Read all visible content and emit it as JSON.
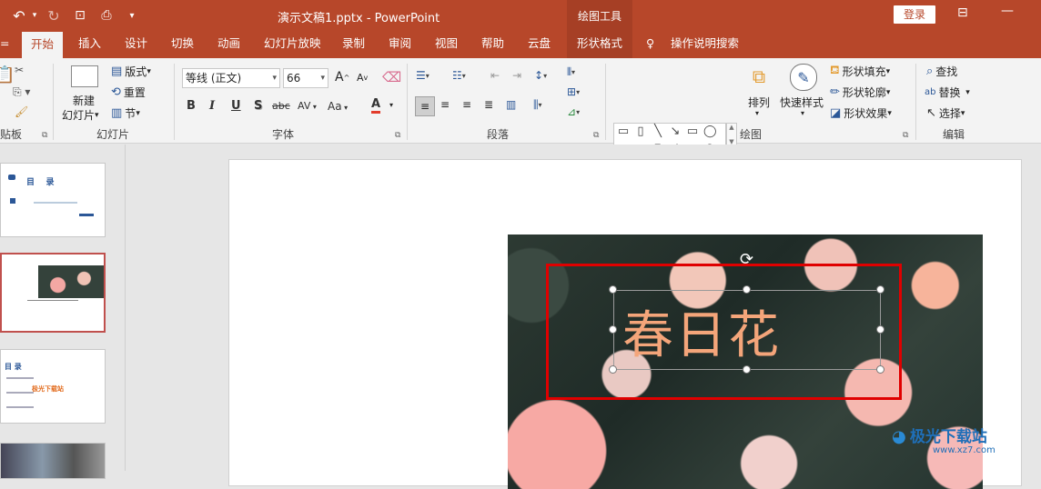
{
  "title_bar": {
    "title": "演示文稿1.pptx  -  PowerPoint",
    "contextual_group": "绘图工具",
    "login": "登录"
  },
  "tabs": [
    {
      "label": "开始"
    },
    {
      "label": "插入"
    },
    {
      "label": "设计"
    },
    {
      "label": "切换"
    },
    {
      "label": "动画"
    },
    {
      "label": "幻灯片放映"
    },
    {
      "label": "录制"
    },
    {
      "label": "审阅"
    },
    {
      "label": "视图"
    },
    {
      "label": "帮助"
    },
    {
      "label": "云盘"
    },
    {
      "label": "形状格式"
    },
    {
      "label": "操作说明搜索"
    }
  ],
  "ribbon": {
    "clipboard": {
      "label": "贴板"
    },
    "slides": {
      "new_slide": "新建",
      "new_slide2": "幻灯片",
      "layout": "版式",
      "reset": "重置",
      "section": "节",
      "label": "幻灯片"
    },
    "font": {
      "font_name": "等线 (正文)",
      "font_size": "66",
      "label": "字体",
      "bold": "B",
      "italic": "I",
      "underline": "U",
      "shadow": "S",
      "strike": "abc",
      "spacing": "AV",
      "case": "Aa",
      "color": "A",
      "grow": "A",
      "shrink": "A"
    },
    "paragraph": {
      "label": "段落"
    },
    "drawing": {
      "arrange": "排列",
      "quick_styles": "快速样式",
      "fill": "形状填充",
      "outline": "形状轮廓",
      "effects": "形状效果",
      "label": "绘图"
    },
    "editing": {
      "find": "查找",
      "replace": "替换",
      "select": "选择",
      "label": "编辑"
    }
  },
  "thumbnails": [
    {
      "title": "目    录"
    },
    {
      "title": ""
    },
    {
      "title": "目 录",
      "badge": "极光下载站"
    },
    {
      "title": ""
    }
  ],
  "slide": {
    "text": "春日花"
  },
  "watermark": {
    "text": "极光下载站",
    "url": "www.xz7.com"
  }
}
